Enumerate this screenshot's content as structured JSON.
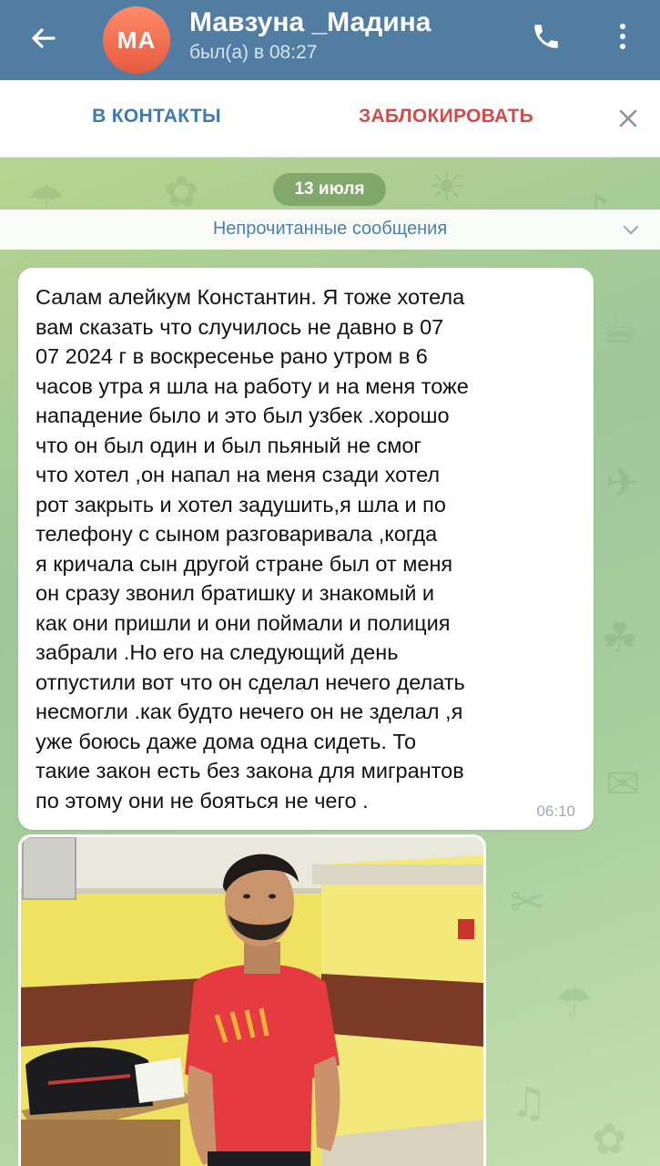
{
  "header": {
    "avatar_initials": "MA",
    "name": "Мавзуна _Мадина",
    "status": "был(а) в 08:27",
    "back_icon": "arrow-left-icon",
    "call_icon": "phone-icon",
    "menu_icon": "more-vertical-icon"
  },
  "action_bar": {
    "add_contact_label": "В КОНТАКТЫ",
    "block_label": "ЗАБЛОКИРОВАТЬ",
    "close_icon": "close-icon"
  },
  "chat": {
    "date_label": "13 июля",
    "unread_label": "Непрочитанные сообщения",
    "message": {
      "lines": [
        "Салам алейкум Константин. Я тоже хотела",
        "вам сказать что случилось не давно в 07",
        "07 2024 г в воскресенье рано утром в 6",
        "часов утра я шла на работу и на меня тоже",
        "нападение было и это был узбек .хорошо",
        "что он был один и был пьяный не смог",
        "что хотел ,он напал на меня сзади хотел",
        "рот закрыть и хотел задушить,я шла и по",
        "телефону с сыном разговаривала ,когда",
        "я кричала сын другой стране был от меня",
        "он сразу звонил братишку и знакомый и",
        "как они пришли и они поймали и полиция",
        "забрали .Но его на следующий день",
        "отпустили  вот что он сделал нечего делать",
        "несмогли .как будто нечего он не зделал ,я",
        "уже боюсь даже дома одна сидеть. То",
        "такие закон есть без закона для мигрантов",
        "по этому они не бояться не чего ."
      ],
      "time": "06:10"
    },
    "photo": {
      "description_icon": "photo-message"
    }
  },
  "colors": {
    "header_bg": "#527da3",
    "accent_blue": "#3d7ab5",
    "danger_red": "#d14b4b",
    "avatar": "#f0714f",
    "chat_bg": "#a9c891"
  }
}
